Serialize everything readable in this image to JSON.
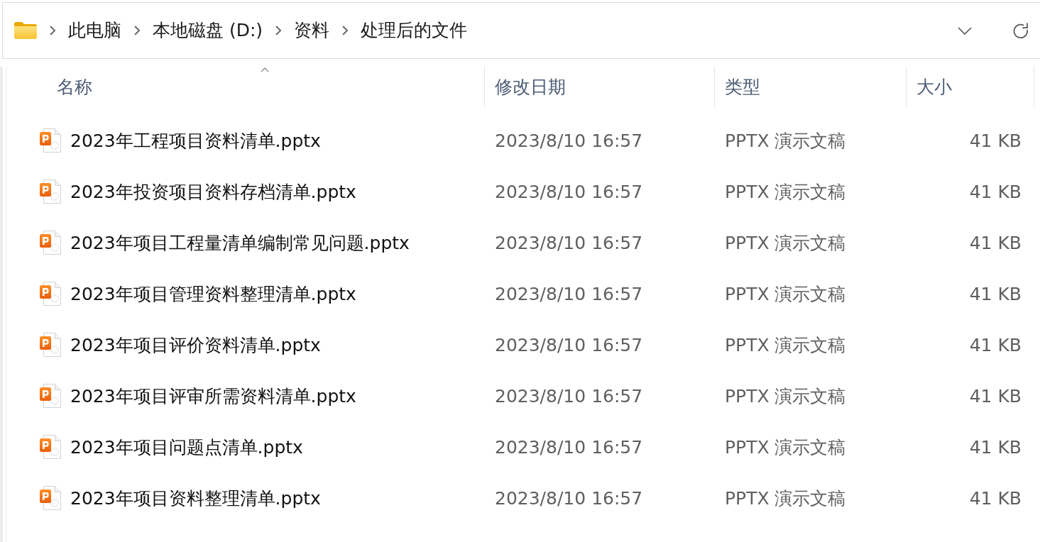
{
  "address_bar": {
    "breadcrumbs": [
      "此电脑",
      "本地磁盘 (D:)",
      "资料",
      "处理后的文件"
    ]
  },
  "columns": [
    {
      "label": "名称",
      "sorted": true
    },
    {
      "label": "修改日期",
      "sorted": false
    },
    {
      "label": "类型",
      "sorted": false
    },
    {
      "label": "大小",
      "sorted": false
    }
  ],
  "files": [
    {
      "name": "2023年工程项目资料清单.pptx",
      "modified": "2023/8/10 16:57",
      "type": "PPTX 演示文稿",
      "size": "41 KB"
    },
    {
      "name": "2023年投资项目资料存档清单.pptx",
      "modified": "2023/8/10 16:57",
      "type": "PPTX 演示文稿",
      "size": "41 KB"
    },
    {
      "name": "2023年项目工程量清单编制常见问题.pptx",
      "modified": "2023/8/10 16:57",
      "type": "PPTX 演示文稿",
      "size": "41 KB"
    },
    {
      "name": "2023年项目管理资料整理清单.pptx",
      "modified": "2023/8/10 16:57",
      "type": "PPTX 演示文稿",
      "size": "41 KB"
    },
    {
      "name": "2023年项目评价资料清单.pptx",
      "modified": "2023/8/10 16:57",
      "type": "PPTX 演示文稿",
      "size": "41 KB"
    },
    {
      "name": "2023年项目评审所需资料清单.pptx",
      "modified": "2023/8/10 16:57",
      "type": "PPTX 演示文稿",
      "size": "41 KB"
    },
    {
      "name": "2023年项目问题点清单.pptx",
      "modified": "2023/8/10 16:57",
      "type": "PPTX 演示文稿",
      "size": "41 KB"
    },
    {
      "name": "2023年项目资料整理清单.pptx",
      "modified": "2023/8/10 16:57",
      "type": "PPTX 演示文稿",
      "size": "41 KB"
    }
  ]
}
